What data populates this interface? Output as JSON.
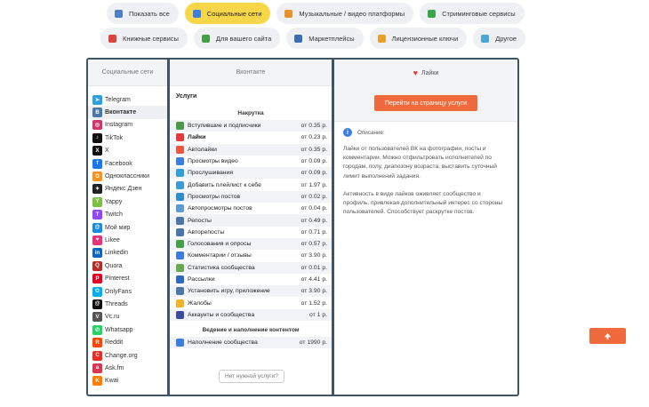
{
  "filters_row1": [
    {
      "label": "Показать все",
      "icon": "share-icon",
      "color": "#4d7ec7"
    },
    {
      "label": "Социальные сети",
      "icon": "people-icon",
      "color": "#3b7de0",
      "active": true
    },
    {
      "label": "Музыкальные / видео платформы",
      "icon": "music-icon",
      "color": "#e6952e"
    },
    {
      "label": "Стриминговые сервисы",
      "icon": "stream-icon",
      "color": "#38a74a"
    }
  ],
  "filters_row2": [
    {
      "label": "Книжные сервисы",
      "icon": "books-icon",
      "color": "#d8453a"
    },
    {
      "label": "Для вашего сайта",
      "icon": "site-icon",
      "color": "#43a047"
    },
    {
      "label": "Маркетплейсы",
      "icon": "cart-icon",
      "color": "#3b6fb5"
    },
    {
      "label": "Лицензионные ключи",
      "icon": "key-icon",
      "color": "#e6a02e"
    },
    {
      "label": "Другое",
      "icon": "globe-icon",
      "color": "#47a6d6"
    }
  ],
  "networks_panel": {
    "title": "Социальные сети",
    "items": [
      {
        "label": "Telegram",
        "icon": "telegram-icon",
        "color": "#2aa3df",
        "glyph": "➤"
      },
      {
        "label": "Вконтакте",
        "icon": "vk-icon",
        "color": "#4a76a8",
        "glyph": "В",
        "selected": true
      },
      {
        "label": "Instagram",
        "icon": "instagram-icon",
        "color": "#d6336c",
        "glyph": "◎"
      },
      {
        "label": "TikTok",
        "icon": "tiktok-icon",
        "color": "#111111",
        "glyph": "♪"
      },
      {
        "label": "X",
        "icon": "x-icon",
        "color": "#111111",
        "glyph": "X"
      },
      {
        "label": "Facebook",
        "icon": "facebook-icon",
        "color": "#1877f2",
        "glyph": "f"
      },
      {
        "label": "Одноклассники",
        "icon": "ok-icon",
        "color": "#f7931e",
        "glyph": "О"
      },
      {
        "label": "Яндекс Дзен",
        "icon": "zen-icon",
        "color": "#222222",
        "glyph": "✦"
      },
      {
        "label": "Yappy",
        "icon": "yappy-icon",
        "color": "#7cc242",
        "glyph": "Y"
      },
      {
        "label": "Twitch",
        "icon": "twitch-icon",
        "color": "#9146ff",
        "glyph": "T"
      },
      {
        "label": "Мой мир",
        "icon": "moymir-icon",
        "color": "#168de2",
        "glyph": "@"
      },
      {
        "label": "Likee",
        "icon": "likee-icon",
        "color": "#e8337a",
        "glyph": "♥"
      },
      {
        "label": "Linkedin",
        "icon": "linkedin-icon",
        "color": "#0a66c2",
        "glyph": "in"
      },
      {
        "label": "Quora",
        "icon": "quora-icon",
        "color": "#b92b27",
        "glyph": "Q"
      },
      {
        "label": "Pinterest",
        "icon": "pinterest-icon",
        "color": "#e60023",
        "glyph": "P"
      },
      {
        "label": "OnlyFans",
        "icon": "onlyfans-icon",
        "color": "#00aff0",
        "glyph": "O"
      },
      {
        "label": "Threads",
        "icon": "threads-icon",
        "color": "#111111",
        "glyph": "@"
      },
      {
        "label": "Vc.ru",
        "icon": "vcru-icon",
        "color": "#555555",
        "glyph": "V"
      },
      {
        "label": "Whatsapp",
        "icon": "whatsapp-icon",
        "color": "#25d366",
        "glyph": "✆"
      },
      {
        "label": "Reddit",
        "icon": "reddit-icon",
        "color": "#ff4500",
        "glyph": "R"
      },
      {
        "label": "Change.org",
        "icon": "changeorg-icon",
        "color": "#ec2c22",
        "glyph": "C"
      },
      {
        "label": "Ask.fm",
        "icon": "askfm-icon",
        "color": "#db3552",
        "glyph": "a"
      },
      {
        "label": "Kwai",
        "icon": "kwai-icon",
        "color": "#ff7e00",
        "glyph": "K"
      }
    ]
  },
  "services_panel": {
    "title": "Вконтакте",
    "subtitle": "Услуги",
    "group1": "Накрутка",
    "items": [
      {
        "label": "Вступившие и подписчики",
        "price": "от 0.35 р.",
        "icon": "subscribers-icon",
        "color": "#4a9a4a"
      },
      {
        "label": "Лайки",
        "price": "от 0.23 р.",
        "icon": "heart-icon",
        "color": "#e23b3b",
        "selected": true
      },
      {
        "label": "Автолайки",
        "price": "от 0.35 р.",
        "icon": "autolike-icon",
        "color": "#e9573f"
      },
      {
        "label": "Просмотры видео",
        "price": "от 0.09 р.",
        "icon": "video-icon",
        "color": "#3b7de0"
      },
      {
        "label": "Прослушивания",
        "price": "от 0.09 р.",
        "icon": "listen-icon",
        "color": "#2f9fd6"
      },
      {
        "label": "Добавить плейлист к себе",
        "price": "от 1.97 р.",
        "icon": "playlist-icon",
        "color": "#3b9bd6"
      },
      {
        "label": "Просмотры постов",
        "price": "от 0.02 р.",
        "icon": "eye-icon",
        "color": "#2e8bd0"
      },
      {
        "label": "Автопросмотры постов",
        "price": "от 0.04 р.",
        "icon": "auto-view-icon",
        "color": "#5b9bd5"
      },
      {
        "label": "Репосты",
        "price": "от 0.49 р.",
        "icon": "share-icon",
        "color": "#4a76a8"
      },
      {
        "label": "Авторепосты",
        "price": "от 0.71 р.",
        "icon": "auto-share-icon",
        "color": "#4a76a8"
      },
      {
        "label": "Голосования и опросы",
        "price": "от 0.57 р.",
        "icon": "poll-icon",
        "color": "#43a047"
      },
      {
        "label": "Комментарии / отзывы",
        "price": "от 3.90 р.",
        "icon": "comment-icon",
        "color": "#3b7de0"
      },
      {
        "label": "Статистика сообщества",
        "price": "от 0.01 р.",
        "icon": "stats-icon",
        "color": "#6aa84f"
      },
      {
        "label": "Рассылки",
        "price": "от 4.41 р.",
        "icon": "mailing-icon",
        "color": "#2d6bbf"
      },
      {
        "label": "Установить игру, приложение",
        "price": "от 3.90 р.",
        "icon": "app-icon",
        "color": "#4a76a8"
      },
      {
        "label": "Жалобы",
        "price": "от 1.52 р.",
        "icon": "complaint-icon",
        "color": "#f0b429"
      },
      {
        "label": "Аккаунты и сообщества",
        "price": "от 1 р.",
        "icon": "accounts-icon",
        "color": "#3b4a9a"
      }
    ],
    "group2": "Ведение и наполнение контентом",
    "items2": [
      {
        "label": "Наполнение сообщества",
        "price": "от 1990 р.",
        "icon": "content-icon",
        "color": "#3b7de0"
      }
    ],
    "no_service_button": "Нет нужной услуги?"
  },
  "detail_panel": {
    "title": "Лайки",
    "button": "Перейти на страницу услуги",
    "desc_label": "Описание:",
    "p1": "Лайки от пользователей ВК на фотографии, посты и комментарии. Можно отфильтровать исполнителей по городам, полу, диапозону возраста, выставить суточный лимит выполнений задания.",
    "p2": "Активность в виде лайков оживляет сообщество и профиль, привлекая дополнительный интерес со стороны пользователей. Способствует раскрутке постов."
  },
  "scroll_top": {
    "icon": "arrow-up-icon"
  }
}
